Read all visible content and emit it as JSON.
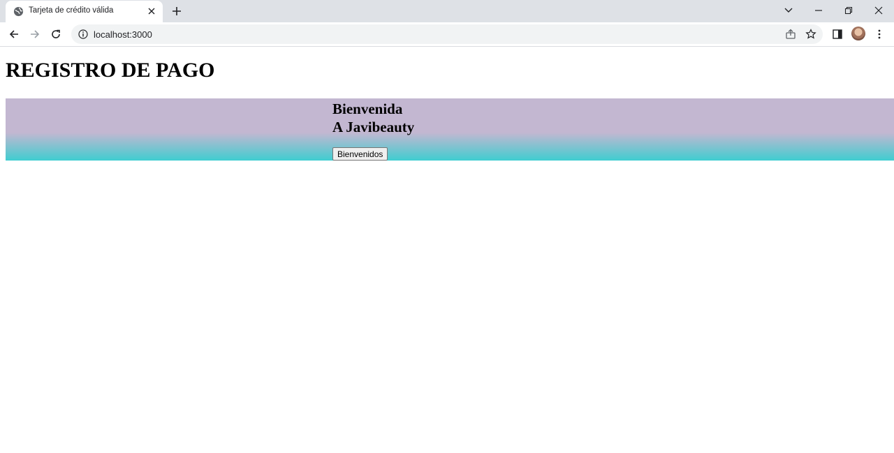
{
  "browser": {
    "tab_title": "Tarjeta de crédito válida",
    "url": "localhost:3000"
  },
  "icons": {
    "tab_favicon": "globe-icon",
    "tab_close": "close-icon",
    "new_tab": "plus-icon",
    "tab_search": "chevron-down-icon",
    "minimize": "minimize-icon",
    "restore": "restore-icon",
    "close_window": "close-icon",
    "back": "arrow-left-icon",
    "forward": "arrow-right-icon",
    "reload": "reload-icon",
    "site_info": "info-icon",
    "share": "share-icon",
    "bookmark": "star-icon",
    "side_panel": "side-panel-icon",
    "menu": "kebab-menu-icon"
  },
  "page": {
    "title": "REGISTRO DE PAGO",
    "banner": {
      "line1": "Bienvenida",
      "line2": "A Javibeauty",
      "button_label": "Bienvenidos"
    }
  },
  "colors": {
    "banner_top": "#c3b7d1",
    "banner_bottom": "#3fcdd0",
    "tabstrip": "#dee1e6",
    "omnibox": "#f1f3f4"
  }
}
